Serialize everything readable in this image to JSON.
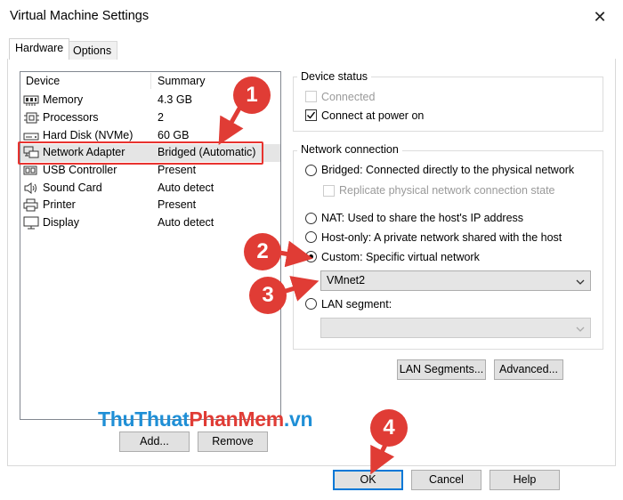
{
  "window": {
    "title": "Virtual Machine Settings",
    "close_glyph": "✕"
  },
  "tabs": [
    {
      "label": "Hardware"
    },
    {
      "label": "Options"
    }
  ],
  "devices": {
    "col_device": "Device",
    "col_summary": "Summary",
    "rows": [
      {
        "name": "Memory",
        "summary": "4.3 GB",
        "icon": "memory-icon"
      },
      {
        "name": "Processors",
        "summary": "2",
        "icon": "processor-icon"
      },
      {
        "name": "Hard Disk (NVMe)",
        "summary": "60 GB",
        "icon": "hard-disk-icon"
      },
      {
        "name": "Network Adapter",
        "summary": "Bridged (Automatic)",
        "icon": "network-adapter-icon",
        "selected": true
      },
      {
        "name": "USB Controller",
        "summary": "Present",
        "icon": "usb-icon"
      },
      {
        "name": "Sound Card",
        "summary": "Auto detect",
        "icon": "speaker-icon"
      },
      {
        "name": "Printer",
        "summary": "Present",
        "icon": "printer-icon"
      },
      {
        "name": "Display",
        "summary": "Auto detect",
        "icon": "monitor-icon"
      }
    ],
    "add_label": "Add...",
    "remove_label": "Remove"
  },
  "device_status": {
    "title": "Device status",
    "connected": "Connected",
    "connect_at_power_on": "Connect at power on"
  },
  "network_connection": {
    "title": "Network connection",
    "bridged": "Bridged: Connected directly to the physical network",
    "replicate": "Replicate physical network connection state",
    "nat": "NAT: Used to share the host's IP address",
    "host_only": "Host-only: A private network shared with the host",
    "custom": "Custom: Specific virtual network",
    "custom_value": "VMnet2",
    "lan_segment": "LAN segment:",
    "lan_segments_button": "LAN Segments...",
    "advanced_button": "Advanced..."
  },
  "footer": {
    "ok": "OK",
    "cancel": "Cancel",
    "help": "Help"
  },
  "annotations": {
    "step1": "1",
    "step2": "2",
    "step3": "3",
    "step4": "4"
  },
  "watermark": {
    "part1": "Thu",
    "part2": "Thuat",
    "part3": "Phan",
    "part4": "Mem",
    "part5": ".vn"
  },
  "colors": {
    "accent": "#0078d7",
    "annotation": "#e03c35",
    "watermark_blue": "#1f8fd6"
  }
}
